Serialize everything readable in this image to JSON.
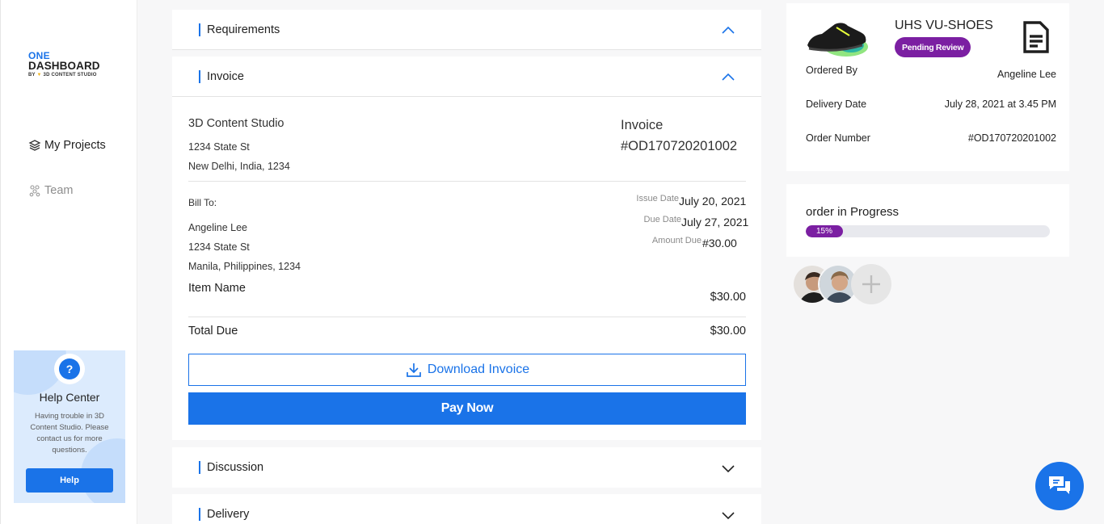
{
  "logo": {
    "line1": "ONE",
    "line2": "DASHBOARD",
    "by": "BY",
    "studio": "3D CONTENT STUDIO"
  },
  "nav": [
    {
      "label": "My Projects",
      "active": true,
      "icon": "layers-icon"
    },
    {
      "label": "Team",
      "active": false,
      "icon": "team-icon"
    }
  ],
  "help": {
    "icon": "?",
    "title": "Help Center",
    "text": "Having trouble in 3D Content Studio. Please contact us for more questions.",
    "button": "Help"
  },
  "sections": {
    "requirements": "Requirements",
    "invoice": "Invoice",
    "discussion": "Discussion",
    "delivery": "Delivery"
  },
  "invoice": {
    "company": "3D Content Studio",
    "company_addr1": "1234 State St",
    "company_addr2": "New Delhi, India, 1234",
    "label": "Invoice",
    "number": "#OD170720201002",
    "bill_to_label": "Bill To:",
    "bill_name": "Angeline Lee",
    "bill_addr1": "1234 State St",
    "bill_addr2": "Manila, Philippines, 1234",
    "issue_label": "Issue Date",
    "issue_value": "July 20, 2021",
    "due_label": "Due Date",
    "due_value": "July 27, 2021",
    "amount_label": "Amount Due",
    "amount_value": "#30.00",
    "item_label": "Item Name",
    "item_price": "$30.00",
    "total_label": "Total Due",
    "total_value": "$30.00",
    "download_label": "Download Invoice",
    "pay_label": "Pay Now"
  },
  "order": {
    "product": "UHS VU-SHOES",
    "status": "Pending Review",
    "ordered_by_label": "Ordered By",
    "ordered_by_value": "Angeline Lee",
    "delivery_label": "Delivery Date",
    "delivery_value": "July 28, 2021 at 3.45 PM",
    "order_no_label": "Order Number",
    "order_no_value": "#OD170720201002"
  },
  "progress": {
    "title": "order in Progress",
    "percent_label": "15%",
    "percent": 15
  },
  "colors": {
    "accent": "#1a73e8",
    "status_purple": "#7b1fa2"
  }
}
